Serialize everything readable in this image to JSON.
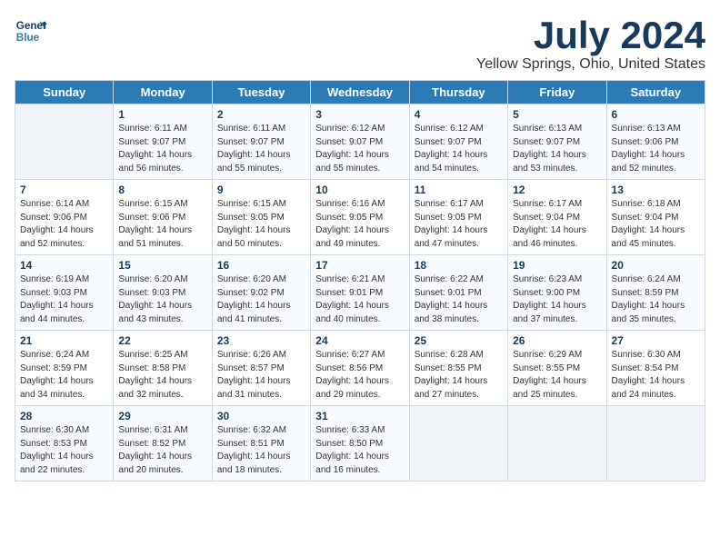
{
  "logo": {
    "line1": "General",
    "line2": "Blue"
  },
  "title": "July 2024",
  "subtitle": "Yellow Springs, Ohio, United States",
  "days_of_week": [
    "Sunday",
    "Monday",
    "Tuesday",
    "Wednesday",
    "Thursday",
    "Friday",
    "Saturday"
  ],
  "weeks": [
    [
      {
        "day": "",
        "info": ""
      },
      {
        "day": "1",
        "info": "Sunrise: 6:11 AM\nSunset: 9:07 PM\nDaylight: 14 hours\nand 56 minutes."
      },
      {
        "day": "2",
        "info": "Sunrise: 6:11 AM\nSunset: 9:07 PM\nDaylight: 14 hours\nand 55 minutes."
      },
      {
        "day": "3",
        "info": "Sunrise: 6:12 AM\nSunset: 9:07 PM\nDaylight: 14 hours\nand 55 minutes."
      },
      {
        "day": "4",
        "info": "Sunrise: 6:12 AM\nSunset: 9:07 PM\nDaylight: 14 hours\nand 54 minutes."
      },
      {
        "day": "5",
        "info": "Sunrise: 6:13 AM\nSunset: 9:07 PM\nDaylight: 14 hours\nand 53 minutes."
      },
      {
        "day": "6",
        "info": "Sunrise: 6:13 AM\nSunset: 9:06 PM\nDaylight: 14 hours\nand 52 minutes."
      }
    ],
    [
      {
        "day": "7",
        "info": "Sunrise: 6:14 AM\nSunset: 9:06 PM\nDaylight: 14 hours\nand 52 minutes."
      },
      {
        "day": "8",
        "info": "Sunrise: 6:15 AM\nSunset: 9:06 PM\nDaylight: 14 hours\nand 51 minutes."
      },
      {
        "day": "9",
        "info": "Sunrise: 6:15 AM\nSunset: 9:05 PM\nDaylight: 14 hours\nand 50 minutes."
      },
      {
        "day": "10",
        "info": "Sunrise: 6:16 AM\nSunset: 9:05 PM\nDaylight: 14 hours\nand 49 minutes."
      },
      {
        "day": "11",
        "info": "Sunrise: 6:17 AM\nSunset: 9:05 PM\nDaylight: 14 hours\nand 47 minutes."
      },
      {
        "day": "12",
        "info": "Sunrise: 6:17 AM\nSunset: 9:04 PM\nDaylight: 14 hours\nand 46 minutes."
      },
      {
        "day": "13",
        "info": "Sunrise: 6:18 AM\nSunset: 9:04 PM\nDaylight: 14 hours\nand 45 minutes."
      }
    ],
    [
      {
        "day": "14",
        "info": "Sunrise: 6:19 AM\nSunset: 9:03 PM\nDaylight: 14 hours\nand 44 minutes."
      },
      {
        "day": "15",
        "info": "Sunrise: 6:20 AM\nSunset: 9:03 PM\nDaylight: 14 hours\nand 43 minutes."
      },
      {
        "day": "16",
        "info": "Sunrise: 6:20 AM\nSunset: 9:02 PM\nDaylight: 14 hours\nand 41 minutes."
      },
      {
        "day": "17",
        "info": "Sunrise: 6:21 AM\nSunset: 9:01 PM\nDaylight: 14 hours\nand 40 minutes."
      },
      {
        "day": "18",
        "info": "Sunrise: 6:22 AM\nSunset: 9:01 PM\nDaylight: 14 hours\nand 38 minutes."
      },
      {
        "day": "19",
        "info": "Sunrise: 6:23 AM\nSunset: 9:00 PM\nDaylight: 14 hours\nand 37 minutes."
      },
      {
        "day": "20",
        "info": "Sunrise: 6:24 AM\nSunset: 8:59 PM\nDaylight: 14 hours\nand 35 minutes."
      }
    ],
    [
      {
        "day": "21",
        "info": "Sunrise: 6:24 AM\nSunset: 8:59 PM\nDaylight: 14 hours\nand 34 minutes."
      },
      {
        "day": "22",
        "info": "Sunrise: 6:25 AM\nSunset: 8:58 PM\nDaylight: 14 hours\nand 32 minutes."
      },
      {
        "day": "23",
        "info": "Sunrise: 6:26 AM\nSunset: 8:57 PM\nDaylight: 14 hours\nand 31 minutes."
      },
      {
        "day": "24",
        "info": "Sunrise: 6:27 AM\nSunset: 8:56 PM\nDaylight: 14 hours\nand 29 minutes."
      },
      {
        "day": "25",
        "info": "Sunrise: 6:28 AM\nSunset: 8:55 PM\nDaylight: 14 hours\nand 27 minutes."
      },
      {
        "day": "26",
        "info": "Sunrise: 6:29 AM\nSunset: 8:55 PM\nDaylight: 14 hours\nand 25 minutes."
      },
      {
        "day": "27",
        "info": "Sunrise: 6:30 AM\nSunset: 8:54 PM\nDaylight: 14 hours\nand 24 minutes."
      }
    ],
    [
      {
        "day": "28",
        "info": "Sunrise: 6:30 AM\nSunset: 8:53 PM\nDaylight: 14 hours\nand 22 minutes."
      },
      {
        "day": "29",
        "info": "Sunrise: 6:31 AM\nSunset: 8:52 PM\nDaylight: 14 hours\nand 20 minutes."
      },
      {
        "day": "30",
        "info": "Sunrise: 6:32 AM\nSunset: 8:51 PM\nDaylight: 14 hours\nand 18 minutes."
      },
      {
        "day": "31",
        "info": "Sunrise: 6:33 AM\nSunset: 8:50 PM\nDaylight: 14 hours\nand 16 minutes."
      },
      {
        "day": "",
        "info": ""
      },
      {
        "day": "",
        "info": ""
      },
      {
        "day": "",
        "info": ""
      }
    ]
  ]
}
